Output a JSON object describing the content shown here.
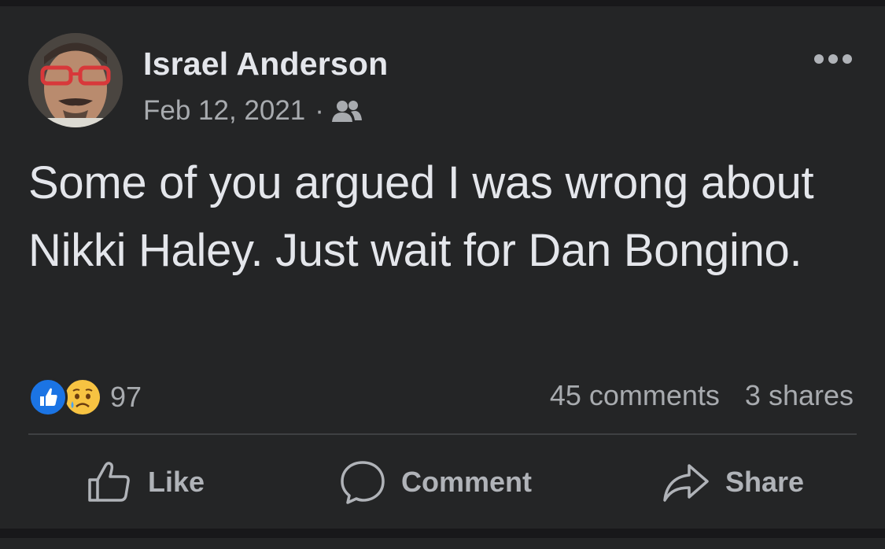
{
  "post": {
    "author": "Israel Anderson",
    "date": "Feb 12, 2021",
    "separator": "·",
    "audience_icon": "friends-icon",
    "text": "Some of you argued I was wrong about Nikki Haley. Just wait for Dan Bongino.",
    "reactions": {
      "types": [
        "like-reaction-icon",
        "sad-reaction-icon"
      ],
      "count": "97"
    },
    "comments": "45 comments",
    "shares": "3 shares"
  },
  "actions": {
    "like_label": "Like",
    "comment_label": "Comment",
    "share_label": "Share"
  },
  "colors": {
    "background": "#242526",
    "text_primary": "#e4e6eb",
    "text_secondary": "#b0b3b8",
    "like_blue": "#1b74e4",
    "sad_yellow": "#f7c342"
  }
}
